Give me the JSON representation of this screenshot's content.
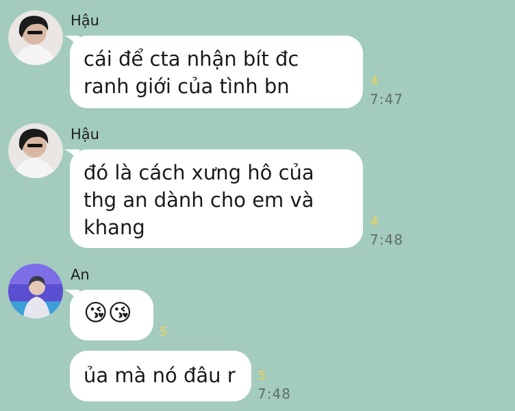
{
  "messages": [
    {
      "sender": "Hậu",
      "lines": [
        "cái để cta nhận bít đc",
        "ranh giới của tình bn"
      ],
      "read_count": "4",
      "time": "7:47"
    },
    {
      "sender": "Hậu",
      "lines": [
        "đó là cách xưng hô của",
        "thg an dành cho em và",
        "khang"
      ],
      "read_count": "4",
      "time": "7:48"
    },
    {
      "sender": "An",
      "emoji": "😘😘",
      "read_count": "5"
    },
    {
      "text": "ủa mà nó đâu r",
      "read_count": "5",
      "time": "7:48"
    }
  ],
  "colors": {
    "background": "#a3cbbe",
    "bubble": "#ffffff",
    "read_indicator": "#f3d34a",
    "timestamp": "#5f6f6a"
  }
}
